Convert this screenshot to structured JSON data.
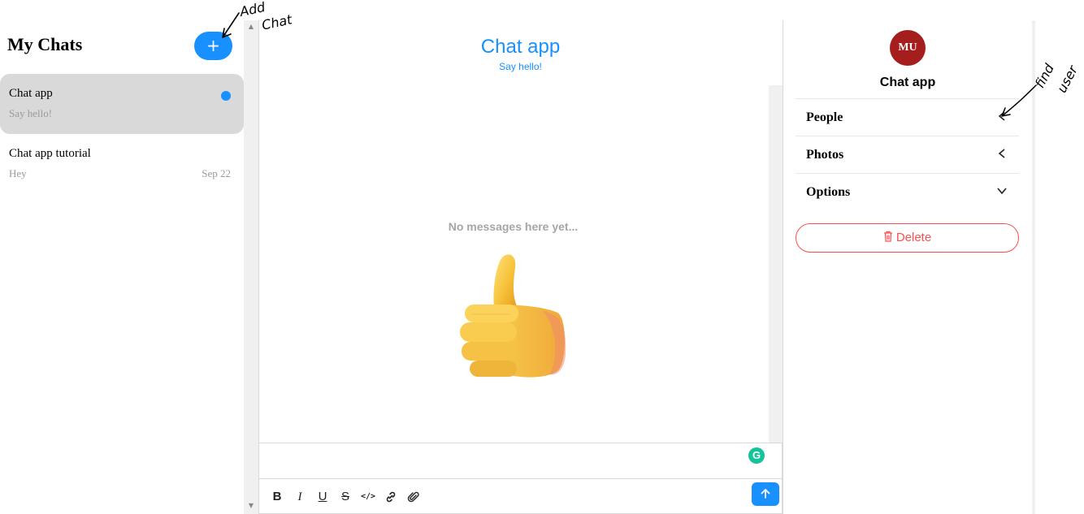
{
  "chat_list": {
    "title": "My Chats",
    "add_button": "+",
    "chats": [
      {
        "title": "Chat app",
        "preview": "Say hello!",
        "date": "",
        "unread": true
      },
      {
        "title": "Chat app tutorial",
        "preview": "Hey",
        "date": "Sep 22",
        "unread": false
      }
    ]
  },
  "feed": {
    "title": "Chat app",
    "subtitle": "Say hello!",
    "empty_text": "No messages here yet...",
    "grammarly_label": "G",
    "toolbar": [
      "B",
      "I",
      "U",
      "S",
      "</>",
      "link",
      "attach"
    ],
    "send_icon": "arrow-up-icon"
  },
  "settings": {
    "avatar_initials": "MU",
    "title": "Chat app",
    "sections": [
      {
        "label": "People",
        "state": "collapsed-left"
      },
      {
        "label": "Photos",
        "state": "collapsed-left"
      },
      {
        "label": "Options",
        "state": "expanded-down"
      }
    ],
    "delete_label": "Delete"
  },
  "annotations": {
    "add_chat": [
      "Add",
      "Chat"
    ],
    "find_user": [
      "find",
      "user"
    ]
  },
  "colors": {
    "accent": "#1890ff",
    "active_card": "#d9d9d9",
    "avatar": "#a61d1d",
    "danger": "#ff4d4f",
    "grammarly": "#15c39a"
  }
}
